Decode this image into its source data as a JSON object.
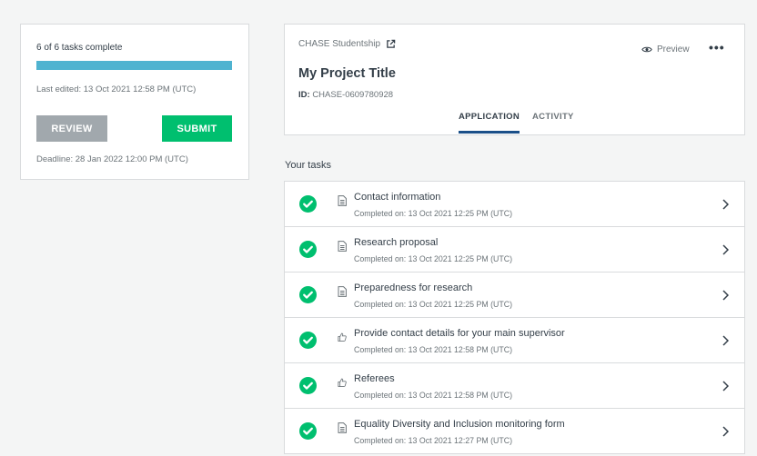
{
  "summary": {
    "tasks_complete": "6 of 6 tasks complete",
    "progress_fraction": 1.0,
    "last_edited": "Last edited: 13 Oct 2021 12:58 PM (UTC)",
    "review_label": "REVIEW",
    "submit_label": "SUBMIT",
    "deadline": "Deadline: 28 Jan 2022 12:00 PM (UTC)"
  },
  "project": {
    "program_name": "CHASE Studentship",
    "program_icon": "external-link-icon",
    "preview_label": "Preview",
    "preview_icon": "eye-icon",
    "more_label": "•••",
    "title": "My Project Title",
    "id_label": "ID:",
    "id_value": "CHASE-0609780928",
    "tabs": [
      {
        "label": "APPLICATION",
        "active": true
      },
      {
        "label": "ACTIVITY",
        "active": false
      }
    ]
  },
  "tasks_heading": "Your tasks",
  "tasks": [
    {
      "title": "Contact information",
      "completed": "Completed on: 13 Oct 2021 12:25 PM (UTC)",
      "icon": "document-icon"
    },
    {
      "title": "Research proposal",
      "completed": "Completed on: 13 Oct 2021 12:25 PM (UTC)",
      "icon": "document-icon"
    },
    {
      "title": "Preparedness for research",
      "completed": "Completed on: 13 Oct 2021 12:25 PM (UTC)",
      "icon": "document-icon"
    },
    {
      "title": "Provide contact details for your main supervisor",
      "completed": "Completed on: 13 Oct 2021 12:58 PM (UTC)",
      "icon": "thumbs-up-icon"
    },
    {
      "title": "Referees",
      "completed": "Completed on: 13 Oct 2021 12:58 PM (UTC)",
      "icon": "thumbs-up-icon"
    },
    {
      "title": "Equality Diversity and Inclusion monitoring form",
      "completed": "Completed on: 13 Oct 2021 12:27 PM (UTC)",
      "icon": "document-icon"
    }
  ],
  "colors": {
    "progress": "#4fb3d0",
    "submit": "#00bf6f",
    "review": "#a1a8ad",
    "check": "#00bf6f",
    "active_tab": "#1a4f88"
  }
}
